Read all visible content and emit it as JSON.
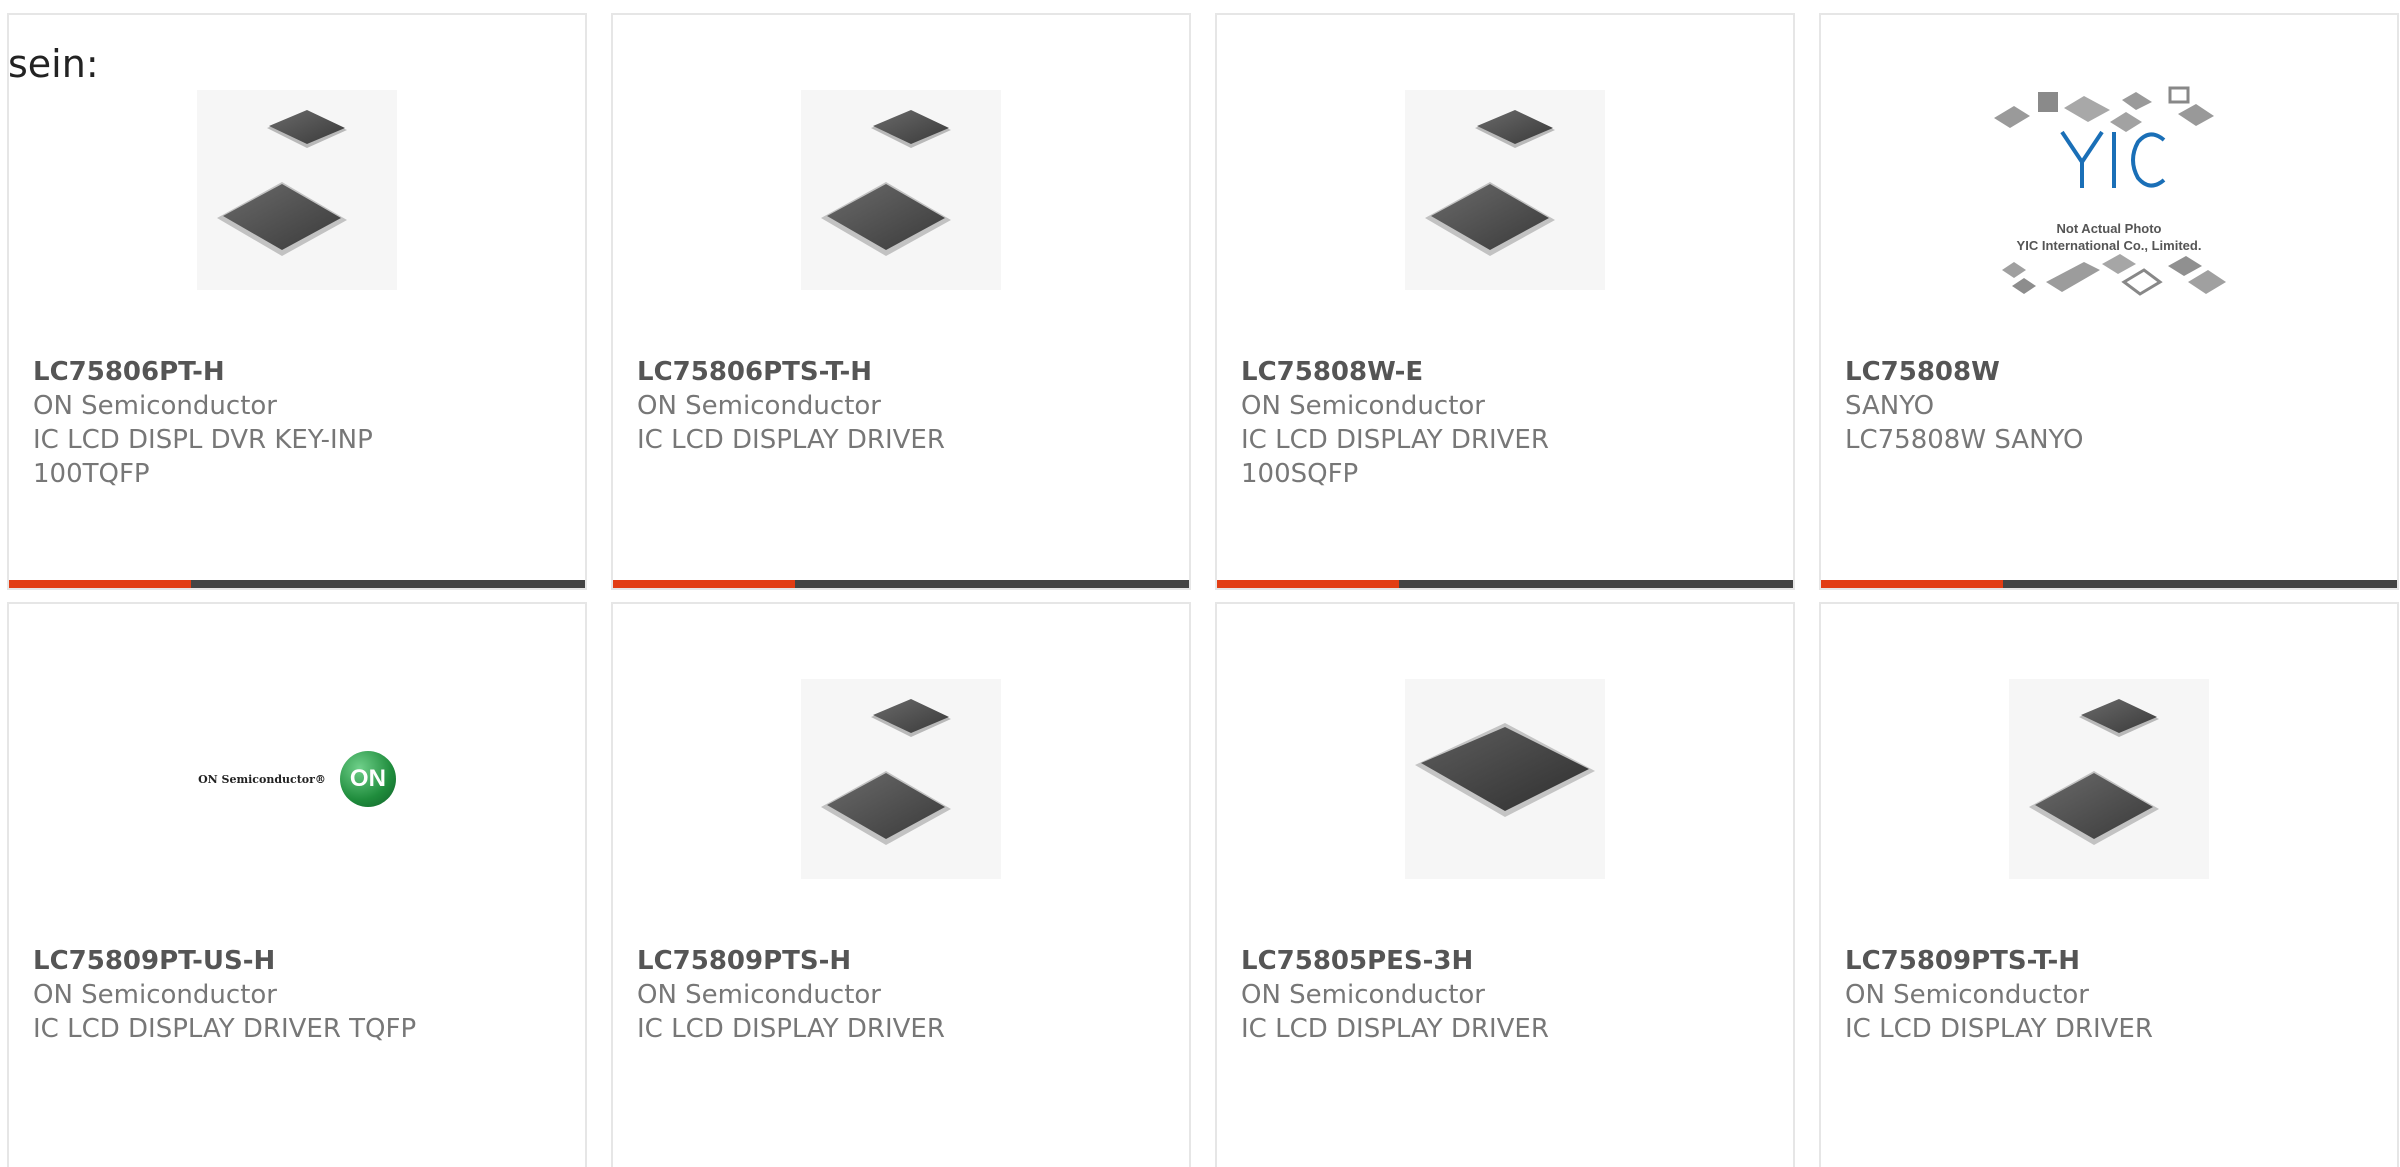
{
  "lead_text": "sein:",
  "colors": {
    "accent_red": "#e23d14",
    "accent_dark": "#444444",
    "card_border": "#e6e6e6",
    "text_gray": "#777777"
  },
  "cards": [
    {
      "part": "LC75806PT-H",
      "maker": "ON Semiconductor",
      "desc1": "IC LCD DISPL DVR KEY-INP",
      "desc2": "100TQFP",
      "image": "chip-pair-icon"
    },
    {
      "part": "LC75806PTS-T-H",
      "maker": "ON Semiconductor",
      "desc1": "IC LCD DISPLAY DRIVER",
      "desc2": "",
      "image": "chip-pair-icon"
    },
    {
      "part": "LC75808W-E",
      "maker": "ON Semiconductor",
      "desc1": "IC LCD DISPLAY DRIVER",
      "desc2": "100SQFP",
      "image": "chip-pair-icon"
    },
    {
      "part": "LC75808W",
      "maker": "SANYO",
      "desc1": "LC75808W SANYO",
      "desc2": "",
      "image": "yic-placeholder-icon",
      "image_text1": "Not Actual Photo",
      "image_text2": "YIC International Co., Limited."
    },
    {
      "part": "LC75809PT-US-H",
      "maker": "ON Semiconductor",
      "desc1": "IC LCD DISPLAY DRIVER TQFP",
      "desc2": "",
      "image": "on-semiconductor-logo",
      "logo_text": "ON Semiconductor®",
      "logo_badge": "ON"
    },
    {
      "part": "LC75809PTS-H",
      "maker": "ON Semiconductor",
      "desc1": "IC LCD DISPLAY DRIVER",
      "desc2": "",
      "image": "chip-pair-icon"
    },
    {
      "part": "LC75805PES-3H",
      "maker": "ON Semiconductor",
      "desc1": "IC LCD DISPLAY DRIVER",
      "desc2": "",
      "image": "single-chip-icon"
    },
    {
      "part": "LC75809PTS-T-H",
      "maker": "ON Semiconductor",
      "desc1": "IC LCD DISPLAY DRIVER",
      "desc2": "",
      "image": "chip-pair-icon"
    }
  ]
}
